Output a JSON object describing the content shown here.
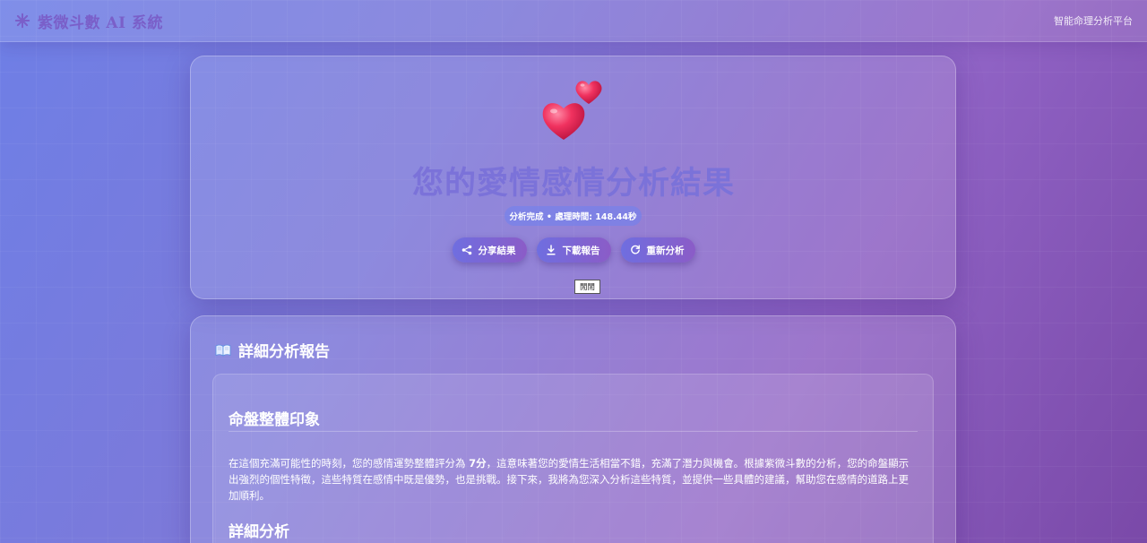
{
  "header": {
    "brand": "紫微斗數 AI 系統",
    "platform": "智能命理分析平台"
  },
  "hero": {
    "title": "您的愛情感情分析結果",
    "status": "分析完成 • 處理時間: 148.44秒",
    "actions": [
      {
        "label": "分享結果",
        "icon": "share-icon"
      },
      {
        "label": "下載報告",
        "icon": "download-icon"
      },
      {
        "label": "重新分析",
        "icon": "refresh-icon"
      }
    ],
    "tooltip": "閒閒"
  },
  "report": {
    "heading": "詳細分析報告",
    "section1_title": "命盤整體印象",
    "para_before": "在這個充滿可能性的時刻，您的感情運勢整體評分為 ",
    "para_score": "7分",
    "para_after": "，這意味著您的愛情生活相當不錯，充滿了潛力與機會。根據紫微斗數的分析，您的命盤顯示出強烈的個性特徵，這些特質在感情中既是優勢，也是挑戰。接下來，我將為您深入分析這些特質，並提供一些具體的建議，幫助您在感情的道路上更加順利。",
    "section2_title": "詳細分析"
  },
  "colors": {
    "accent": "#7b72d9",
    "button": "#7468dc",
    "heart": "#f0325f"
  }
}
